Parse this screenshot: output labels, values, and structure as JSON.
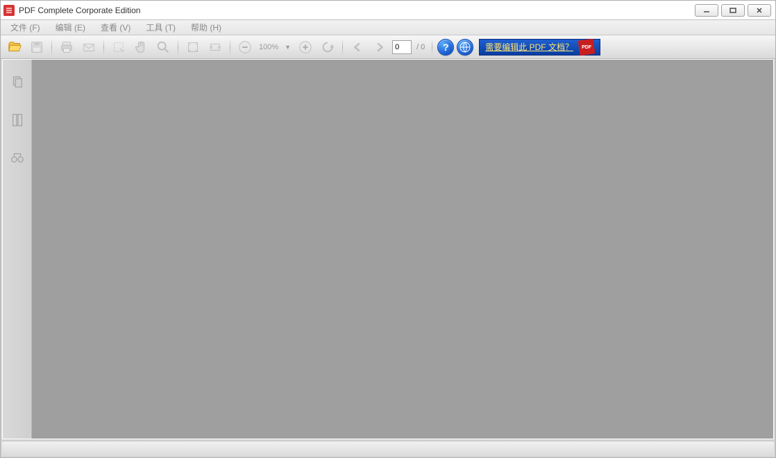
{
  "window": {
    "title": "PDF Complete Corporate Edition"
  },
  "menu": {
    "file": "文件 (F)",
    "edit": "编辑 (E)",
    "view": "查看 (V)",
    "tools": "工具 (T)",
    "help": "帮助 (H)"
  },
  "toolbar": {
    "zoom_level": "100%",
    "page_current": "0",
    "page_total": "/ 0",
    "help_glyph": "?",
    "banner_text": "需要编辑此 PDF 文档？",
    "pdf_badge": "PDF"
  }
}
